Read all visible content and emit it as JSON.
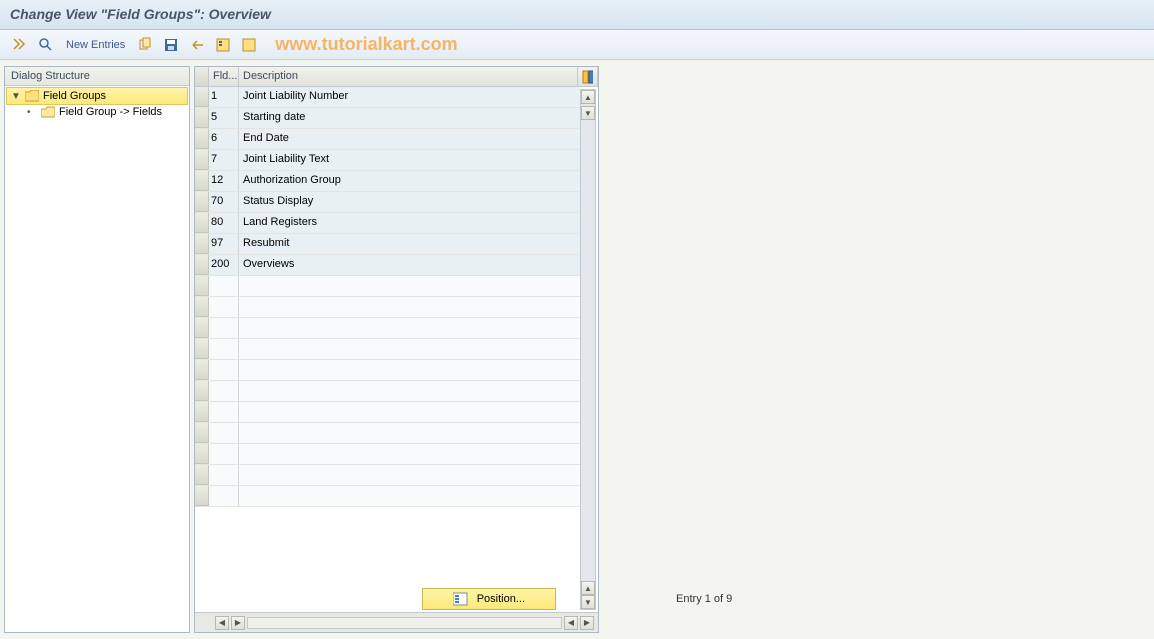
{
  "header": {
    "title": "Change View \"Field Groups\": Overview"
  },
  "toolbar": {
    "new_entries": "New Entries"
  },
  "watermark": "www.tutorialkart.com",
  "dialog": {
    "title": "Dialog Structure",
    "nodes": [
      {
        "label": "Field Groups",
        "selected": true,
        "level": 0,
        "expanded": true
      },
      {
        "label": "Field Group -> Fields",
        "selected": false,
        "level": 1,
        "expanded": false
      }
    ]
  },
  "table": {
    "columns": {
      "col1": "Fld...",
      "col2": "Description"
    },
    "rows": [
      {
        "fld": "1",
        "desc": "Joint Liability Number"
      },
      {
        "fld": "5",
        "desc": "Starting date"
      },
      {
        "fld": "6",
        "desc": "End Date"
      },
      {
        "fld": "7",
        "desc": "Joint Liability Text"
      },
      {
        "fld": "12",
        "desc": "Authorization Group"
      },
      {
        "fld": "70",
        "desc": "Status Display"
      },
      {
        "fld": "80",
        "desc": "Land Registers"
      },
      {
        "fld": "97",
        "desc": "Resubmit"
      },
      {
        "fld": "200",
        "desc": "Overviews"
      }
    ],
    "empty_rows": 11
  },
  "footer": {
    "position_label": "Position...",
    "entry_text": "Entry 1 of 9"
  }
}
